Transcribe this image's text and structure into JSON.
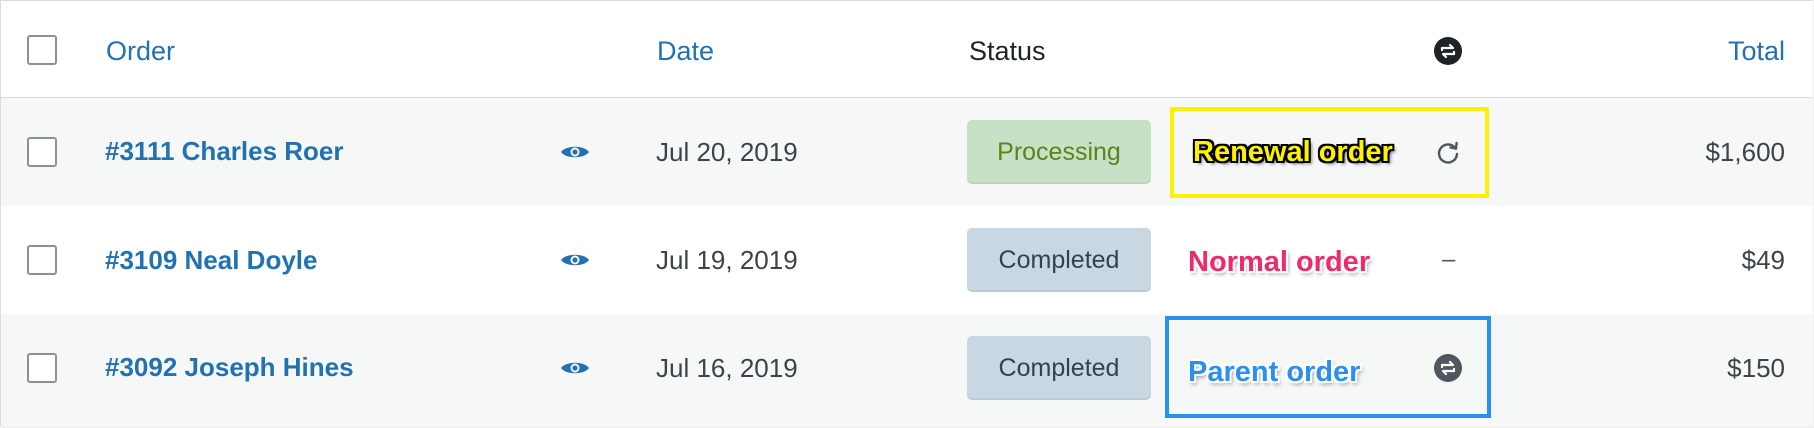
{
  "header": {
    "order_label": "Order",
    "date_label": "Date",
    "status_label": "Status",
    "subscription_icon": "subscription-relationship-icon",
    "total_label": "Total"
  },
  "rows": [
    {
      "order": "#3111 Charles Roer",
      "date": "Jul 20, 2019",
      "status": "Processing",
      "relationship_icon": "renewal-icon",
      "annotation": "Renewal order",
      "total": "$1,600"
    },
    {
      "order": "#3109 Neal Doyle",
      "date": "Jul 19, 2019",
      "status": "Completed",
      "relationship_icon": "dash",
      "relationship_text": "–",
      "annotation": "Normal order",
      "total": "$49"
    },
    {
      "order": "#3092 Joseph Hines",
      "date": "Jul 16, 2019",
      "status": "Completed",
      "relationship_icon": "parent-subscription-icon",
      "annotation": "Parent order",
      "total": "$150"
    }
  ],
  "colors": {
    "link": "#2271b1",
    "processing_bg": "#c6e1c6",
    "processing_text": "#5b841b",
    "completed_bg": "#c8d7e1",
    "completed_text": "#2e4453",
    "renewal_annotation": "#fff200",
    "normal_annotation": "#ee2a6b",
    "parent_annotation": "#2a8ff0"
  }
}
